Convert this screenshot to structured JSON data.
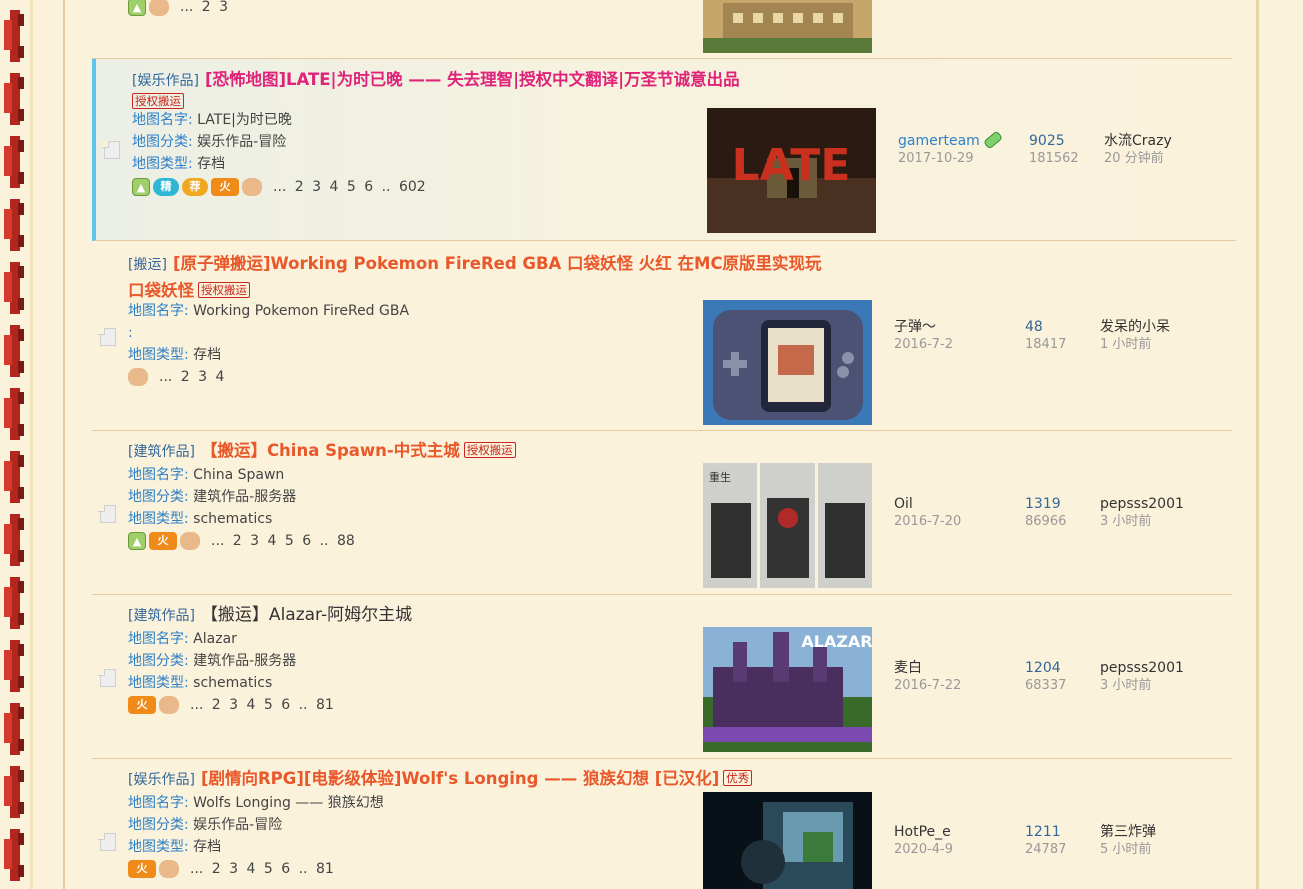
{
  "top_row": {
    "pages": "... 2  3"
  },
  "threads": [
    {
      "category": "[娱乐作品]",
      "title": "[恐怖地图]LATE|为时已晚 —— 失去理智|授权中文翻译|万圣节诚意出品",
      "stamp": "授权搬运",
      "fields": [
        {
          "key": "地图名字",
          "value": "LATE|为时已晚"
        },
        {
          "key": "地图分类",
          "value": "娱乐作品-冒险"
        },
        {
          "key": "地图类型",
          "value": "存档"
        }
      ],
      "pages": "... 2  3  4  5  6 .. 602",
      "author": "gamerteam",
      "date": "2017-10-29",
      "replies": "9025",
      "views": "181562",
      "last_user": "水流Crazy",
      "last_time": "20 分钟前"
    },
    {
      "category": "[搬运]",
      "title_line1": "[原子弹搬运]Working Pokemon FireRed GBA 口袋妖怪 火红 在MC原版里实现玩",
      "title_line2": "口袋妖怪",
      "stamp": "授权搬运",
      "fields": [
        {
          "key": "地图名字",
          "value": "Working Pokemon FireRed GBA"
        },
        {
          "key": "",
          "value": ":"
        },
        {
          "key": "地图类型",
          "value": "存档"
        }
      ],
      "pages": "... 2  3  4",
      "author": "子弹～",
      "date": "2016-7-2",
      "replies": "48",
      "views": "18417",
      "last_user": "发呆的小呆",
      "last_time": "1 小时前"
    },
    {
      "category": "[建筑作品]",
      "title": "【搬运】China Spawn-中式主城",
      "stamp": "授权搬运",
      "fields": [
        {
          "key": "地图名字",
          "value": "China Spawn"
        },
        {
          "key": "地图分类",
          "value": "建筑作品-服务器"
        },
        {
          "key": "地图类型",
          "value": "schematics"
        }
      ],
      "pages": "... 2  3  4  5  6 .. 88",
      "author": "Oil",
      "date": "2016-7-20",
      "replies": "1319",
      "views": "86966",
      "last_user": "pepsss2001",
      "last_time": "3 小时前"
    },
    {
      "category": "[建筑作品]",
      "title": "【搬运】Alazar-阿姆尔主城",
      "fields": [
        {
          "key": "地图名字",
          "value": "Alazar"
        },
        {
          "key": "地图分类",
          "value": "建筑作品-服务器"
        },
        {
          "key": "地图类型",
          "value": "schematics"
        }
      ],
      "pages": "... 2  3  4  5  6 .. 81",
      "author": "麦白",
      "date": "2016-7-22",
      "replies": "1204",
      "views": "68337",
      "last_user": "pepsss2001",
      "last_time": "3 小时前"
    },
    {
      "category": "[娱乐作品]",
      "title": "[剧情向RPG][电影级体验]Wolf's Longing —— 狼族幻想 [已汉化]",
      "stamp": "优秀",
      "fields": [
        {
          "key": "地图名字",
          "value": "Wolfs Longing —— 狼族幻想"
        },
        {
          "key": "地图分类",
          "value": "娱乐作品-冒险"
        },
        {
          "key": "地图类型",
          "value": "存档"
        }
      ],
      "pages": "... 2  3  4  5  6 .. 81",
      "author": "HotPe_e",
      "date": "2020-4-9",
      "replies": "1211",
      "views": "24787",
      "last_user": "第三炸弹",
      "last_time": "5 小时前"
    }
  ],
  "icons": {
    "jing": "精",
    "jian": "荐",
    "huo": "火",
    "image": "▲",
    "thumb": "👍"
  },
  "image_texts": {
    "late": "LATE",
    "alazar": "ALAZAR",
    "china_vertical": "重生"
  },
  "colors": {
    "accent_blue": "#2e80c8",
    "title_pink": "#e0237a",
    "title_orange": "#e8582a",
    "highlight_border": "#5cc6ec"
  }
}
